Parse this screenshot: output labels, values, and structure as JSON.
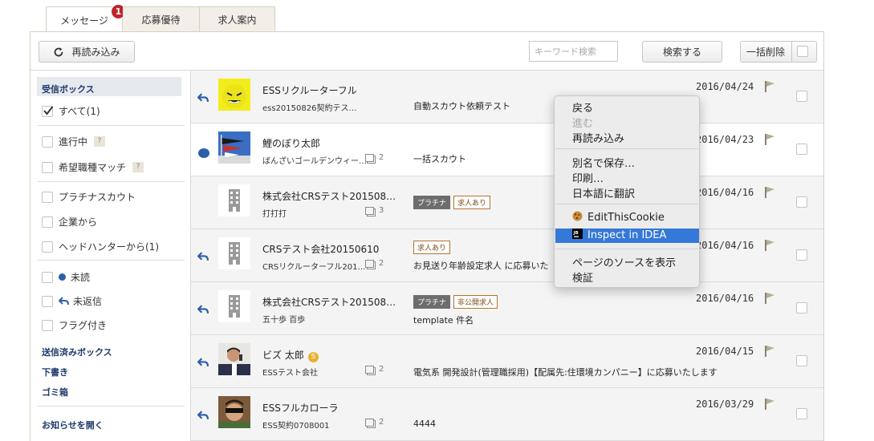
{
  "tabs": [
    {
      "label": "メッセージ",
      "badge": "1"
    },
    {
      "label": "応募優待"
    },
    {
      "label": "求人案内"
    }
  ],
  "toolbar": {
    "reload_label": "再読み込み",
    "search_placeholder": "キーワード検索",
    "search_label": "検索する",
    "bulk_delete_label": "一括削除"
  },
  "sidebar": {
    "inbox": "受信ボックス",
    "all": "すべて(1)",
    "in_progress": "進行中",
    "job_match": "希望職種マッチ",
    "help": "?",
    "platinum": "プラチナスカウト",
    "company": "企業から",
    "headhunter": "ヘッドハンターから(1)",
    "unread": "未読",
    "unreplied": "未返信",
    "flagged": "フラグ付き",
    "sent": "送信済みボックス",
    "drafts": "下書き",
    "trash": "ゴミ箱",
    "notice": "お知らせを開く"
  },
  "messages": [
    {
      "name": "ESSリクルーターフル",
      "sub": "ess20150826契約テス…",
      "count": "",
      "tags": [],
      "subject": "自動スカウト依頼テスト",
      "date": "2016/04/24"
    },
    {
      "name": "鯉のぼり太郎",
      "sub": "ばんざいゴールデンウィー…",
      "count": "2",
      "tags": [],
      "subject": "一括スカウト",
      "date": "2016/04/23"
    },
    {
      "name": "株式会社CRSテスト201508…",
      "sub": "打打打",
      "count": "3",
      "tags": [
        "プラチナ",
        "求人あり"
      ],
      "subject": "",
      "date": "2016/04/16"
    },
    {
      "name": "CRSテスト会社20150610",
      "sub": "CRSリクルーターフル201…",
      "count": "2",
      "tags": [
        "求人あり"
      ],
      "subject": "お見送り年齢設定求人 に応募いた",
      "date": "2016/04/16"
    },
    {
      "name": "株式会社CRSテスト201508…",
      "sub": "五十歩 百歩",
      "count": "",
      "tags": [
        "プラチナ",
        "非公開求人"
      ],
      "subject": "template 件名",
      "date": "2016/04/16"
    },
    {
      "name": "ビズ 太郎",
      "sub": "ESSテスト会社",
      "count": "2",
      "tags": [],
      "subject": "電気系 開発設計(管理職採用)【配属先:住環境カンパニー】に応募いたします",
      "date": "2016/04/15"
    },
    {
      "name": "ESSフルカローラ",
      "sub": "ESS契約0708001",
      "count": "2",
      "tags": [],
      "subject": "4444",
      "date": "2016/03/29"
    }
  ],
  "context_menu": {
    "back": "戻る",
    "forward": "進む",
    "reload": "再読み込み",
    "save_as": "別名で保存…",
    "print": "印刷…",
    "translate": "日本語に翻訳",
    "edit_cookie": "EditThisCookie",
    "inspect_idea": "Inspect in IDEA",
    "view_source": "ページのソースを表示",
    "inspect": "検証"
  },
  "colors": {
    "accent": "#1e3a6b",
    "badge": "#c0242c",
    "highlight": "#3478d8",
    "reply_icon": "#2a5ea8"
  }
}
